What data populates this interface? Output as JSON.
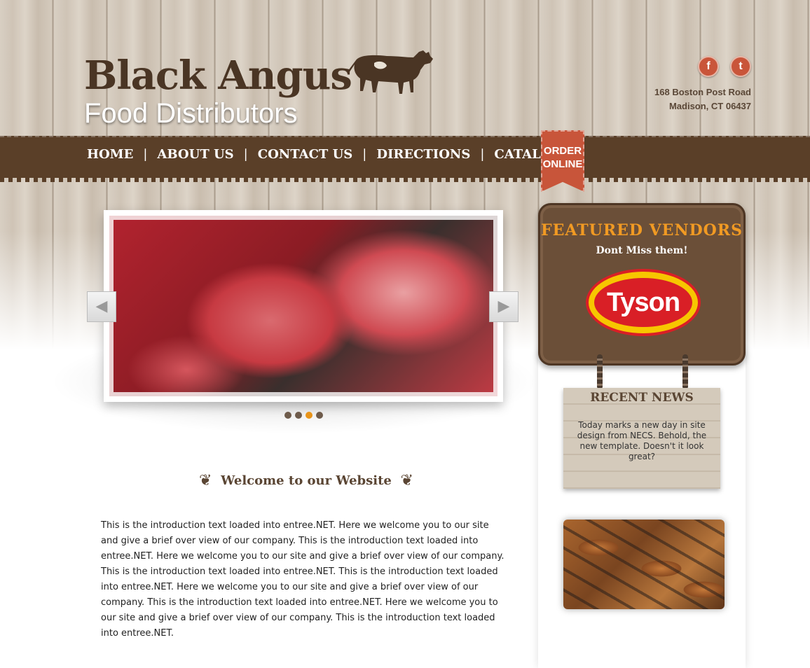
{
  "brand": {
    "title": "Black Angus",
    "subtitle": "Food Distributors"
  },
  "social": {
    "facebook_glyph": "f",
    "twitter_glyph": "t"
  },
  "address": {
    "line1": "168 Boston Post Road",
    "line2": "Madison, CT 06437"
  },
  "nav": {
    "items": [
      {
        "label": "HOME"
      },
      {
        "label": "ABOUT US"
      },
      {
        "label": "CONTACT US"
      },
      {
        "label": "DIRECTIONS"
      },
      {
        "label": "CATALOG"
      }
    ],
    "separator": "|"
  },
  "order_online": {
    "line1": "ORDER",
    "line2": "ONLINE"
  },
  "slider": {
    "prev_glyph": "◀",
    "next_glyph": "▶",
    "dot_count": 4,
    "active_dot": 3
  },
  "welcome": {
    "title": "Welcome to our Website",
    "flourish_left": "❦",
    "flourish_right": "❦"
  },
  "intro_text": "This is the introduction text loaded into entree.NET. Here we welcome you to our site and give a brief over view of our company.  This is the introduction text loaded into entree.NET. Here we welcome you to our site and give a brief over view of our company.  This is the introduction text loaded into entree.NET.  This is the introduction text loaded into entree.NET. Here we welcome you to our site and give a brief over view of our company.  This is the introduction text loaded into entree.NET. Here we welcome you to our site and give a brief over view of our company.  This is the introduction text loaded into entree.NET.",
  "featured_vendors": {
    "title": "FEATURED VENDORS",
    "subtitle": "Dont Miss them!",
    "vendor_name": "Tyson"
  },
  "recent_news": {
    "title": "RECENT NEWS",
    "body": "Today marks a new day in site design from NECS. Behold, the new template. Doesn't it look great?"
  },
  "colors": {
    "brown": "#5a3f28",
    "accent_orange": "#e8941a",
    "ribbon_red": "#c8553a"
  }
}
